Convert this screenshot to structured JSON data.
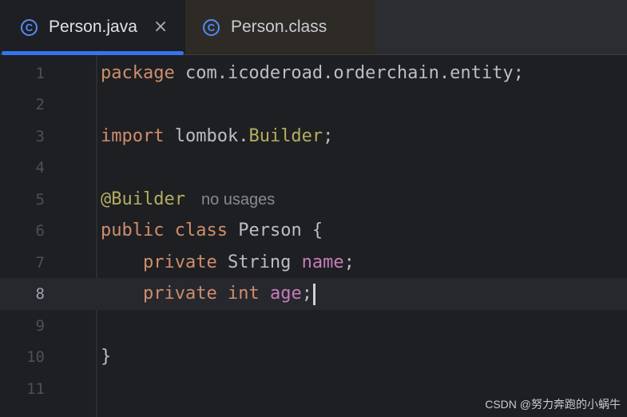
{
  "tabs": [
    {
      "label": "Person.java",
      "icon": "class-icon",
      "active": true,
      "close": "×"
    },
    {
      "label": "Person.class",
      "icon": "class-icon",
      "active": false
    }
  ],
  "class_icon_glyph": "C",
  "editor": {
    "current_line": 8,
    "lines": [
      {
        "num": "1",
        "package_kw": "package",
        "package_name": " com.icoderoad.orderchain.entity;"
      },
      {
        "num": "2"
      },
      {
        "num": "3",
        "import_kw": "import",
        "import_pre": " lombok.",
        "import_cls": "Builder",
        "import_end": ";"
      },
      {
        "num": "4"
      },
      {
        "num": "5",
        "annotation": "@Builder",
        "hint": "no usages"
      },
      {
        "num": "6",
        "kw1": "public",
        "kw2": "class",
        "rest": " Person {"
      },
      {
        "num": "7",
        "indent": "    ",
        "kw": "private",
        "type": " String ",
        "field": "name",
        "end": ";"
      },
      {
        "num": "8",
        "indent": "    ",
        "kw": "private",
        "type_kw": "int",
        "field": "age",
        "end": ";"
      },
      {
        "num": "9"
      },
      {
        "num": "10",
        "brace": "}"
      },
      {
        "num": "11"
      }
    ]
  },
  "watermark": "CSDN @努力奔跑的小蜗牛",
  "colors": {
    "background": "#1e1f22",
    "keyword": "#cf8e6d",
    "annotation": "#b3ae60",
    "field": "#c77dbb",
    "text": "#bcbec4",
    "accent": "#3574f0"
  }
}
